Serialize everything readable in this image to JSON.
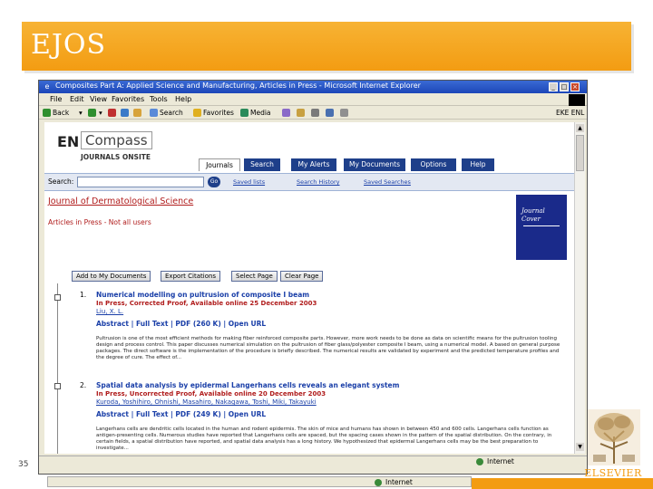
{
  "slide": {
    "title": "EJOS",
    "number": "35",
    "brand": "ELSEVIER"
  },
  "window": {
    "title": "Composites Part A: Applied Science and Manufacturing, Articles in Press - Microsoft Internet Explorer",
    "menu": [
      "File",
      "Edit",
      "View",
      "Favorites",
      "Tools",
      "Help"
    ],
    "toolbar": {
      "back": "Back",
      "search": "Search",
      "favorites": "Favorites",
      "media": "Media",
      "right": "EKE ENL"
    },
    "status": "Internet",
    "taskbar_status": "Internet"
  },
  "page": {
    "logo_en": "EN",
    "logo_compass": "Compass",
    "logo_sub": "JOURNALS ONSITE",
    "tabs": [
      "Journals",
      "Search",
      "My Alerts",
      "My Documents",
      "Options",
      "Help"
    ],
    "search_label": "Search:",
    "go": "Go",
    "search_links": [
      "Saved lists",
      "Search History",
      "Saved Searches"
    ],
    "journal_title": "Journal of Dermatological Science",
    "aip_label": "Articles in Press - Not all users",
    "cover_text": "Journal Cover",
    "actions": [
      "Add to My Documents",
      "Export Citations",
      "Select Page",
      "Clear Page"
    ],
    "results": [
      {
        "num": "1.",
        "title": "Numerical modelling on pultrusion of composite I beam",
        "status": "In Press, Corrected Proof, Available online 25 December 2003",
        "authors": "Liu, X. L.",
        "links": "Abstract | Full Text | PDF (260 K) | Open URL",
        "abstract": "Pultrusion is one of the most efficient methods for making fiber reinforced composite parts. However, more work needs to be done as data on scientific means for the pultrusion tooling design and process control. This paper discusses numerical simulation on the pultrusion of fiber glass/polyester composite I beam, using a numerical model. A based on general purpose packages. The direct software is the implementation of the procedure is briefly described. The numerical results are validated by experiment and the predicted temperature profiles and the degree of cure. The effect of..."
      },
      {
        "num": "2.",
        "title": "Spatial data analysis by epidermal Langerhans cells reveals an elegant system",
        "status": "In Press, Uncorrected Proof, Available online 20 December 2003",
        "authors": "Kuroda, Yoshihiro, Ohnishi, Masahiro, Nakagawa, Toshi, Miki, Takayuki",
        "links": "Abstract | Full Text | PDF (249 K) | Open URL",
        "abstract": "Langerhans cells are dendritic cells located in the human and rodent epidermis. The skin of mice and humans has shown in between 450 and 600 cells. Langerhans cells function as antigen-presenting cells. Numerous studies have reported that Langerhans cells are spaced, but the spacing cases shown in the pattern of the spatial distribution. On the contrary, in certain fields, a spatial distribution have reported, and spatial data analysis has a long history. We hypothesized that epidermal Langerhans cells may be the best preparation to investigate..."
      }
    ]
  }
}
